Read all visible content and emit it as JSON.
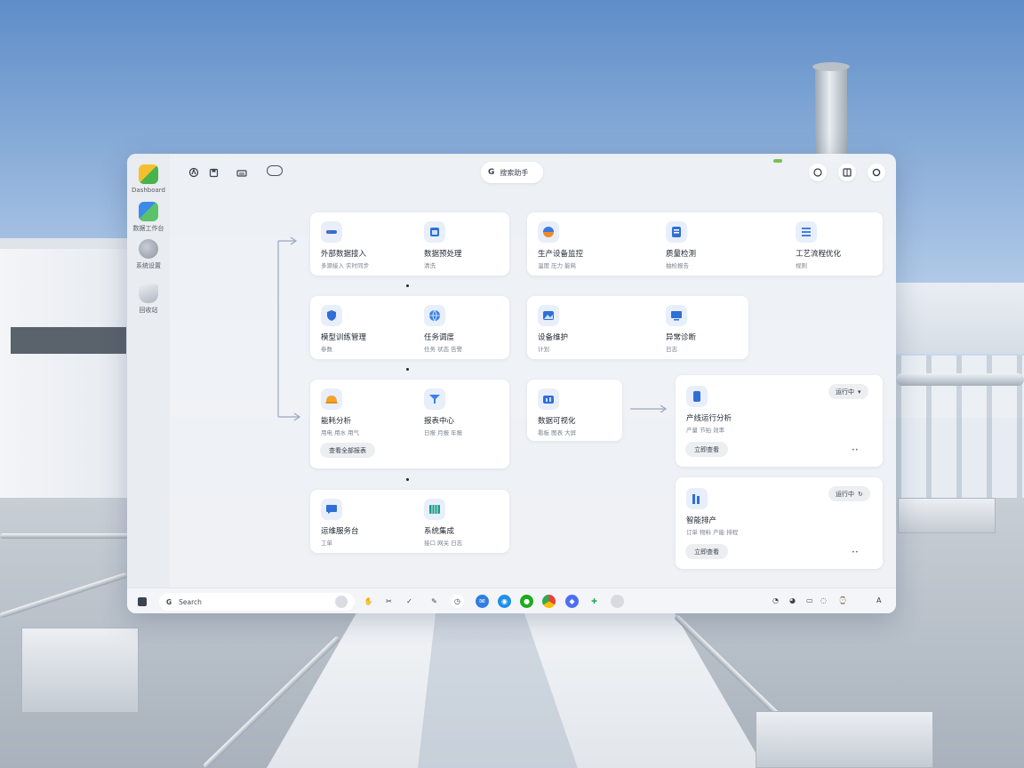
{
  "window": {
    "search_text": "搜索助手",
    "sidebar": [
      {
        "label": "Dashboard"
      },
      {
        "label": "数据工作台"
      },
      {
        "label": "系统设置"
      },
      {
        "label": "回收站"
      }
    ],
    "topbar_icons": [
      "app-icon",
      "save-icon",
      "print-icon",
      "toggle-icon"
    ],
    "top_right_icons": [
      "help-icon",
      "layout-icon",
      "settings-icon"
    ]
  },
  "workflow": {
    "row1_left": [
      {
        "title": "外部数据接入",
        "sub": "多源接入 实时同步",
        "icon": "pen-icon"
      },
      {
        "title": "数据预处理",
        "sub": "清洗",
        "icon": "calendar-icon"
      }
    ],
    "row1_right": [
      {
        "title": "生产设备监控",
        "sub": "温度 压力 能耗",
        "icon": "color-icon"
      },
      {
        "title": "质量检测",
        "sub": "抽检报告",
        "icon": "document-icon"
      },
      {
        "title": "工艺流程优化",
        "sub": "规则",
        "icon": "code-icon"
      }
    ],
    "row2_left": [
      {
        "title": "模型训练管理",
        "sub": "参数",
        "icon": "shield-icon"
      },
      {
        "title": "任务调度",
        "sub": "任务 状态 告警",
        "icon": "globe-icon"
      }
    ],
    "row2_right": [
      {
        "title": "设备维护",
        "sub": "计划",
        "icon": "image-icon"
      },
      {
        "title": "异常诊断",
        "sub": "日志",
        "icon": "monitor-icon"
      }
    ],
    "row3_left": [
      {
        "title": "能耗分析",
        "sub": "用电 用水 用气",
        "icon": "helmet-icon"
      },
      {
        "title": "报表中心",
        "sub": "日报 月报 年报",
        "icon": "funnel-icon"
      }
    ],
    "row3_chip": "查看全部报表",
    "row3_mid": {
      "title": "数据可视化",
      "sub": "看板 图表 大屏",
      "icon": "chart-icon"
    },
    "row4_left": [
      {
        "title": "运维服务台",
        "sub": "工单",
        "icon": "chat-icon"
      },
      {
        "title": "系统集成",
        "sub": "接口 网关 日志",
        "icon": "grid-icon"
      }
    ],
    "detail_cards": [
      {
        "title": "产线运行分析",
        "sub": "产量 节拍 效率",
        "chip": "运行中",
        "badge": "立即查看",
        "note": "••"
      },
      {
        "title": "智能排产",
        "sub": "订单 物料 产能 排程",
        "chip": "运行中",
        "badge": "立即查看",
        "note": "••"
      }
    ]
  },
  "taskbar": {
    "search_placeholder": "Search",
    "icons": [
      "hand-icon",
      "cut-icon",
      "check-icon",
      "pen-icon",
      "clock-icon",
      "mail-icon",
      "browser-icon",
      "wechat-icon",
      "chrome-icon",
      "vpn-icon",
      "pin-icon",
      "cloud-icon"
    ],
    "tray": "A"
  },
  "colors": {
    "accent_blue": "#2f7de1",
    "chip_bg": "#eceef2",
    "window_bg": "#f0f2f6"
  }
}
